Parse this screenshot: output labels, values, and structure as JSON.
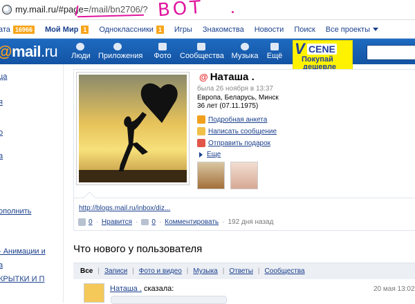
{
  "address_bar": {
    "url_prefix": "my.mail.ru/#page=",
    "url_path": "/mail/bn2706/?",
    "annotation": "ВОТ",
    "annotation_dot": "."
  },
  "topnav": {
    "items": [
      {
        "label": "ата",
        "badge": "16966"
      },
      {
        "label": "Мой Мир",
        "badge": "1"
      },
      {
        "label": "Одноклассники",
        "badge": "1"
      },
      {
        "label": "Игры"
      },
      {
        "label": "Знакомства"
      },
      {
        "label": "Новости"
      },
      {
        "label": "Поиск"
      },
      {
        "label": "Все проекты"
      }
    ]
  },
  "header": {
    "logo_at": "@",
    "logo_text": "mail",
    "logo_tld": ".ru",
    "items": [
      "Люди",
      "Приложения",
      "Фото",
      "Сообщества",
      "Музыка",
      "Ещё"
    ],
    "promo": {
      "brand_v": "V",
      "brand": "CENE",
      "line1": "Покупай",
      "line2": "дешевле"
    }
  },
  "sidebar": {
    "items": [
      "ца",
      "я",
      "о",
      "а",
      "ополнить",
      "- Анимации и",
      "а",
      "КРЫТКИ И П"
    ]
  },
  "profile": {
    "at": "@",
    "name": "Наташа .",
    "last_seen": "была 26  ноября  в 13:37",
    "location": "Европа, Беларусь, Минск",
    "age": "36 лет (07.11.1975)",
    "actions": [
      "Подробная анкета",
      "Написать сообщение",
      "Отправить подарок",
      "Еще"
    ]
  },
  "status": {
    "link": "http://blogs.mail.ru/inbox/diz...",
    "likes": "0",
    "like_label": "Нравится",
    "comments": "0",
    "comment_label": "Комментировать",
    "ago": "192 дня назад"
  },
  "feed": {
    "title": "Что нового у пользователя",
    "tabs": [
      "Все",
      "Записи",
      "Фото и видео",
      "Музыка",
      "Ответы",
      "Сообщества"
    ],
    "entry": {
      "name": "Наташа .",
      "action": "сказала:",
      "time": "20 мая 13:02"
    }
  },
  "colors": {
    "header_blue": "#1a5fb4",
    "link": "#1a3f8c",
    "badge": "#f7a51b",
    "promo_yellow": "#fff200",
    "annotation": "#e0159e"
  }
}
